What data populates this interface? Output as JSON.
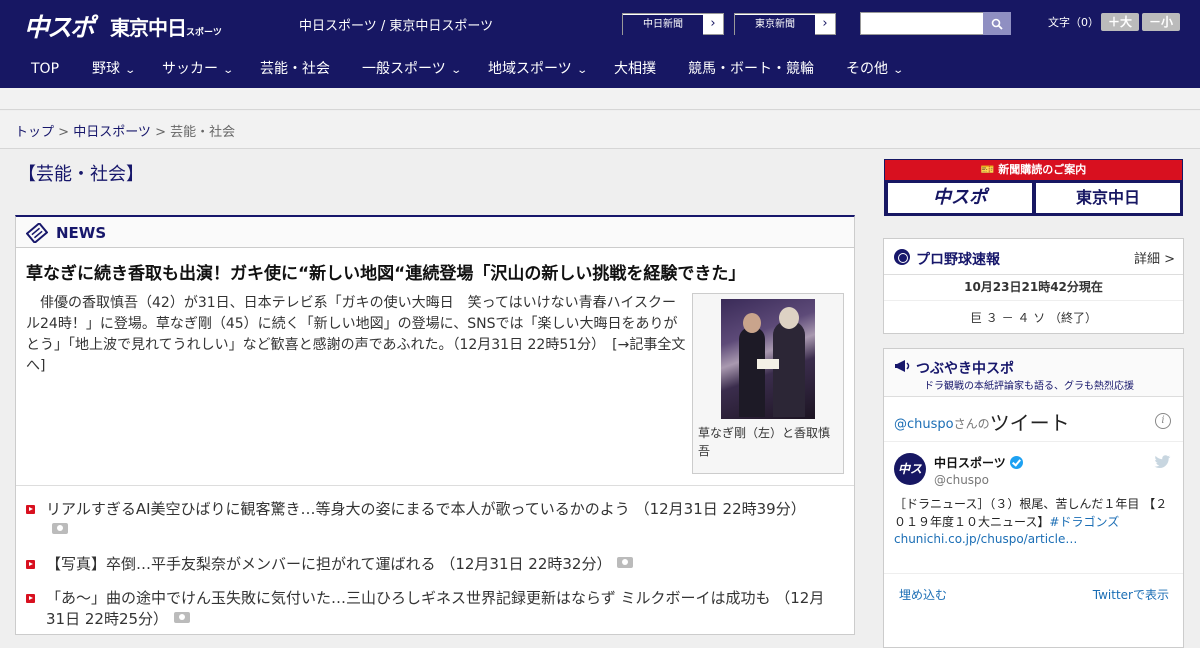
{
  "header": {
    "logo_chu": "中スポ",
    "logo_tokyo": "東京中日",
    "logo_tokyo_small": "スポーツ",
    "site_links": "中日スポーツ / 東京中日スポーツ",
    "chunichi_btn": "中日新聞",
    "tokyo_btn": "東京新聞",
    "search_placeholder": "",
    "font_label": "文字（0）",
    "font_larger": "＋大",
    "font_smaller": "－小"
  },
  "nav": {
    "items": [
      {
        "label": "TOP",
        "has_menu": false
      },
      {
        "label": "野球",
        "has_menu": true
      },
      {
        "label": "サッカー",
        "has_menu": true
      },
      {
        "label": "芸能・社会",
        "has_menu": false
      },
      {
        "label": "一般スポーツ",
        "has_menu": true
      },
      {
        "label": "地域スポーツ",
        "has_menu": true
      },
      {
        "label": "大相撲",
        "has_menu": false
      },
      {
        "label": "競馬・ボート・競輪",
        "has_menu": false
      },
      {
        "label": "その他",
        "has_menu": true
      }
    ]
  },
  "breadcrumb": {
    "top": "トップ",
    "sep1": " > ",
    "chunichi": "中日スポーツ",
    "sep2": " > ",
    "current": "芸能・社会"
  },
  "section_title": "【芸能・社会】",
  "news": {
    "label": "NEWS",
    "headline": "草なぎに続き香取も出演！ガキ使に“新しい地図“連続登場「沢山の新しい挑戦を経験できた」",
    "lead": "　俳優の香取慎吾（42）が31日、日本テレビ系「ガキの使い大晦日　笑ってはいけない青春ハイスクール24時！」に登場。草なぎ剛（45）に続く「新しい地図」の登場に、SNSでは「楽しい大晦日をありがとう」「地上波で見れてうれしい」など歓喜と感謝の声であふれた。（12月31日 22時51分）　",
    "more": "[→記事全文へ]",
    "photo_caption": "草なぎ剛（左）と香取慎吾",
    "items": [
      {
        "text": "リアルすぎるAI美空ひばりに観客驚き…等身大の姿にまるで本人が歌っているかのよう",
        "time": "（12月31日 22時39分）",
        "photo": true
      },
      {
        "text": "【写真】卒倒…平手友梨奈がメンバーに担がれて運ばれる",
        "time": "（12月31日 22時32分）",
        "photo": true
      },
      {
        "text": "「あ～」曲の途中でけん玉失敗に気付いた…三山ひろしギネス世界記録更新はならず ミルクボーイは成功も",
        "time": "（12月31日 22時25分）",
        "photo": true
      }
    ]
  },
  "subscribe": {
    "banner": "新聞購読のご案内",
    "logo_left": "中スポ",
    "logo_right": "東京中日"
  },
  "baseball": {
    "title": "プロ野球速報",
    "detail": "詳細 >",
    "updated": "10月23日21時42分現在",
    "game": "巨 ３ － ４ ソ （終了）"
  },
  "tweets": {
    "title": "つぶやき中スポ",
    "subtitle": "ドラ観戦の本紙評論家も語る、グラも熱烈応援",
    "handle_prefix": "@chuspo",
    "san": "さんの",
    "tweets_word": "ツイート",
    "avatar_text": "中スポ",
    "name": "中日スポーツ",
    "handle": "@chuspo",
    "body": "［ドラニュース］（３）根尾、苦しんだ１年目 【２０１９年度１０大ニュース】",
    "hashtag": "#ドラゴンズ",
    "link": "chunichi.co.jp/chuspo/article…",
    "embed": "埋め込む",
    "view": "Twitterで表示"
  }
}
